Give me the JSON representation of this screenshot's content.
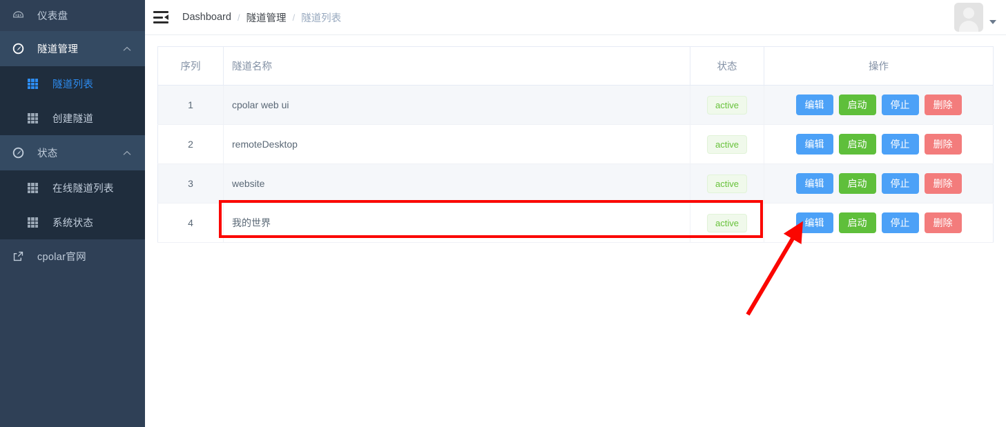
{
  "sidebar": {
    "dashboard": {
      "label": "仪表盘",
      "icon": "dashboard-gauge-icon"
    },
    "groups": [
      {
        "label": "隧道管理",
        "icon": "compass-icon",
        "chevron": "chevron-up-icon",
        "items": [
          {
            "label": "隧道列表",
            "icon": "grid-table-icon",
            "selected": true
          },
          {
            "label": "创建隧道",
            "icon": "grid-table-icon",
            "selected": false
          }
        ]
      },
      {
        "label": "状态",
        "icon": "compass-icon",
        "chevron": "chevron-up-icon",
        "items": [
          {
            "label": "在线隧道列表",
            "icon": "grid-table-icon",
            "selected": false
          },
          {
            "label": "系统状态",
            "icon": "grid-table-icon",
            "selected": false
          }
        ]
      }
    ],
    "external": {
      "label": "cpolar官网",
      "icon": "external-link-icon"
    }
  },
  "topbar": {
    "menu_toggle_icon": "hamburger-collapse-icon",
    "breadcrumb": [
      {
        "label": "Dashboard",
        "muted": false
      },
      {
        "label": "隧道管理",
        "muted": false
      },
      {
        "label": "隧道列表",
        "muted": true
      }
    ],
    "separator": "/",
    "avatar_icon": "user-avatar-icon",
    "caret_icon": "chevron-down-icon"
  },
  "table": {
    "headers": {
      "seq": "序列",
      "name": "隧道名称",
      "state": "状态",
      "ops": "操作"
    },
    "actions": {
      "edit": "编辑",
      "start": "启动",
      "stop": "停止",
      "delete": "删除"
    },
    "rows": [
      {
        "seq": "1",
        "name": "cpolar web ui",
        "state": "active"
      },
      {
        "seq": "2",
        "name": "remoteDesktop",
        "state": "active"
      },
      {
        "seq": "3",
        "name": "website",
        "state": "active"
      },
      {
        "seq": "4",
        "name": "我的世界",
        "state": "active"
      }
    ]
  },
  "annotations": {
    "highlight_color": "#fb0600",
    "highlight_target": "我的世界",
    "arrow_target": "编辑"
  }
}
